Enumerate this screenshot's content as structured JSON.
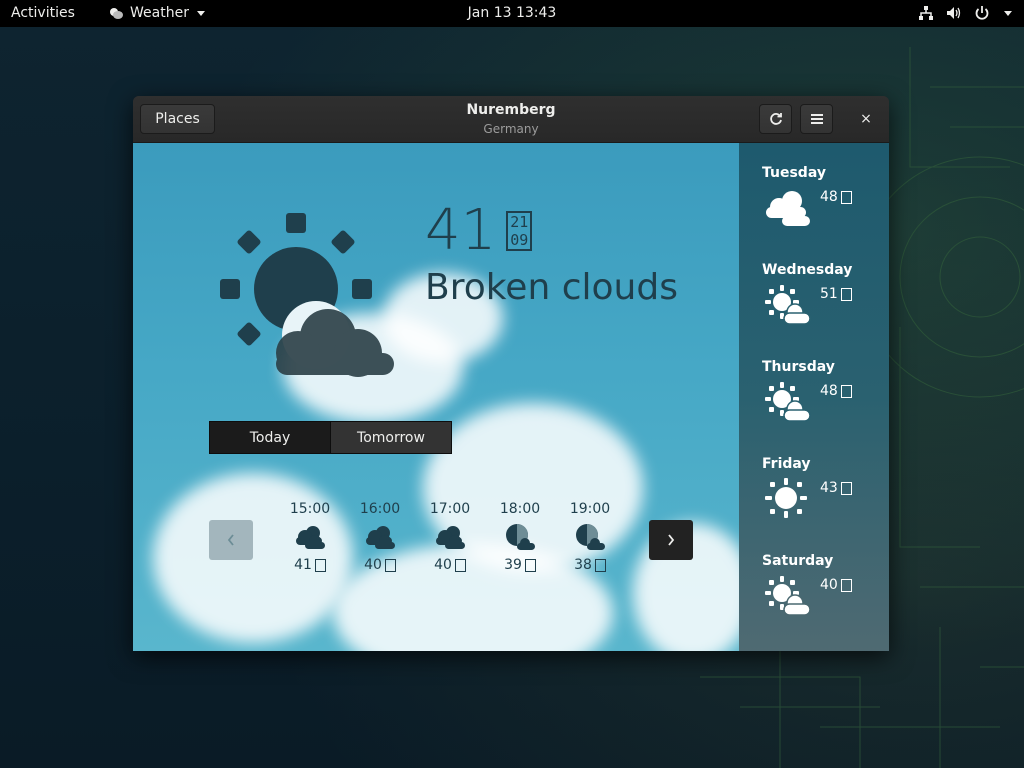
{
  "topbar": {
    "activities": "Activities",
    "app_name": "Weather",
    "clock": "Jan 13  13:43",
    "icons": [
      "network-icon",
      "volume-icon",
      "power-icon"
    ]
  },
  "window": {
    "title": "Nuremberg",
    "subtitle": "Germany",
    "places_label": "Places",
    "refresh_icon": "refresh-icon",
    "menu_icon": "hamburger-menu-icon",
    "close_label": "×"
  },
  "current": {
    "temperature": "41",
    "unit_glyph_top": "21",
    "unit_glyph_bottom": "09",
    "condition": "Broken clouds",
    "icon": "sun-behind-cloud-icon"
  },
  "toggle": {
    "today": "Today",
    "tomorrow": "Tomorrow",
    "selected": "Today"
  },
  "hourly": [
    {
      "time": "15:00",
      "temp": "41",
      "icon": "overcast-icon"
    },
    {
      "time": "16:00",
      "temp": "40",
      "icon": "overcast-icon"
    },
    {
      "time": "17:00",
      "temp": "40",
      "icon": "overcast-icon"
    },
    {
      "time": "18:00",
      "temp": "39",
      "icon": "night-cloud-icon"
    },
    {
      "time": "19:00",
      "temp": "38",
      "icon": "night-cloud-icon"
    }
  ],
  "forecast": [
    {
      "day": "Tuesday",
      "temp": "48",
      "icon": "overcast-icon"
    },
    {
      "day": "Wednesday",
      "temp": "51",
      "icon": "sun-cloud-icon"
    },
    {
      "day": "Thursday",
      "temp": "48",
      "icon": "sun-cloud-icon"
    },
    {
      "day": "Friday",
      "temp": "43",
      "icon": "sun-icon"
    },
    {
      "day": "Saturday",
      "temp": "40",
      "icon": "sun-cloud-icon"
    }
  ],
  "colors": {
    "sky_top": "#3b9bbd",
    "icon_dark": "#1f3f4c",
    "sidebar": "#1e5a6e"
  }
}
